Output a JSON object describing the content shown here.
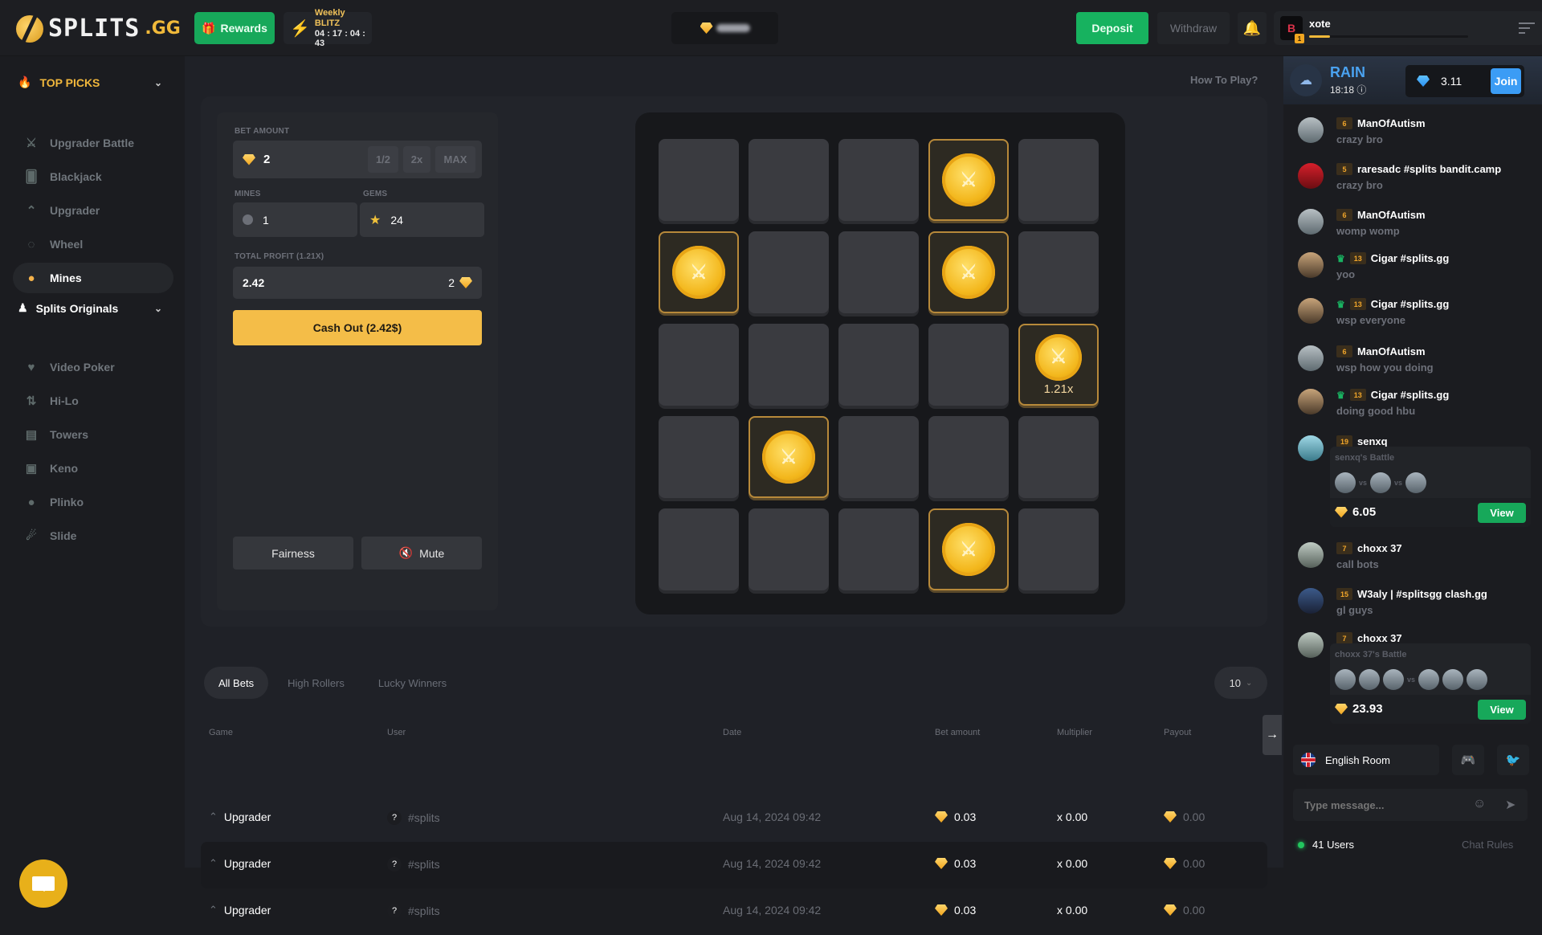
{
  "header": {
    "logo_text": "SPLITS",
    "logo_suffix": ".GG",
    "rewards_label": "Rewards",
    "blitz_title": "Weekly BLITZ",
    "blitz_countdown": "04 : 17 : 04 : 43",
    "deposit_label": "Deposit",
    "withdraw_label": "Withdraw",
    "username": "xote",
    "user_level": "1",
    "xp_progress_percent": 13
  },
  "sidebar": {
    "top_picks_label": "TOP PICKS",
    "top_picks": [
      {
        "label": "Upgrader Battle",
        "icon": "swords-icon"
      },
      {
        "label": "Blackjack",
        "icon": "cards-icon"
      },
      {
        "label": "Upgrader",
        "icon": "chevrons-up-icon"
      },
      {
        "label": "Wheel",
        "icon": "wheel-icon"
      },
      {
        "label": "Mines",
        "icon": "bomb-icon",
        "active": true
      }
    ],
    "originals_label": "Splits Originals",
    "originals": [
      {
        "label": "Video Poker",
        "icon": "poker-cards-icon"
      },
      {
        "label": "Hi-Lo",
        "icon": "hilo-icon"
      },
      {
        "label": "Towers",
        "icon": "towers-icon"
      },
      {
        "label": "Keno",
        "icon": "keno-icon"
      },
      {
        "label": "Plinko",
        "icon": "plinko-icon"
      },
      {
        "label": "Slide",
        "icon": "slide-icon"
      }
    ]
  },
  "game": {
    "how_to_play": "How To Play?",
    "bet_amount_label": "BET AMOUNT",
    "bet_amount": "2",
    "half_label": "1/2",
    "double_label": "2x",
    "max_label": "MAX",
    "mines_label": "MINES",
    "mines_value": "1",
    "gems_label": "GEMS",
    "gems_value": "24",
    "profit_label": "TOTAL PROFIT (1.21X)",
    "profit_value": "2.42",
    "profit_bet": "2",
    "cashout_label": "Cash Out (2.42$)",
    "fairness_label": "Fairness",
    "mute_label": "Mute",
    "grid_rows": 5,
    "grid_cols": 5,
    "revealed_gems": [
      [
        0,
        3
      ],
      [
        1,
        0
      ],
      [
        1,
        3
      ],
      [
        2,
        4
      ],
      [
        3,
        1
      ],
      [
        4,
        3
      ]
    ],
    "last_reveal": [
      2,
      4
    ],
    "last_reveal_multiplier": "1.21x"
  },
  "bets": {
    "tabs": [
      "All Bets",
      "High Rollers",
      "Lucky Winners"
    ],
    "active_tab": 0,
    "page_size": "10",
    "columns": [
      "Game",
      "User",
      "Date",
      "Bet amount",
      "Multiplier",
      "Payout"
    ],
    "rows": [
      {
        "game": "Upgrader",
        "user": "#splits",
        "date": "Aug 14, 2024 09:42",
        "amount": "0.03",
        "multiplier": "x 0.00",
        "payout": "0.00"
      },
      {
        "game": "Upgrader",
        "user": "#splits",
        "date": "Aug 14, 2024 09:42",
        "amount": "0.03",
        "multiplier": "x 0.00",
        "payout": "0.00"
      },
      {
        "game": "Upgrader",
        "user": "#splits",
        "date": "Aug 14, 2024 09:42",
        "amount": "0.03",
        "multiplier": "x 0.00",
        "payout": "0.00"
      }
    ]
  },
  "chat": {
    "rain_title": "RAIN",
    "rain_time": "18:18",
    "rain_amount": "3.11",
    "join_label": "Join",
    "messages": [
      {
        "level": "6",
        "name": "ManOfAutism",
        "text": "crazy bro"
      },
      {
        "level": "5",
        "name": "raresadc #splits bandit.camp",
        "text": "crazy bro"
      },
      {
        "level": "6",
        "name": "ManOfAutism",
        "text": "womp womp"
      },
      {
        "level": "13",
        "name": "Cigar #splits.gg",
        "text": "yoo",
        "crown": true
      },
      {
        "level": "13",
        "name": "Cigar #splits.gg",
        "text": "wsp everyone",
        "crown": true
      },
      {
        "level": "6",
        "name": "ManOfAutism",
        "text": "wsp how you doing"
      },
      {
        "level": "13",
        "name": "Cigar #splits.gg",
        "text": "doing good hbu",
        "crown": true
      },
      {
        "level": "19",
        "name": "senxq",
        "battle": {
          "title": "senxq's Battle",
          "value": "6.05",
          "view_label": "View",
          "vs": "vs"
        }
      },
      {
        "level": "7",
        "name": "choxx 37",
        "text": "call bots"
      },
      {
        "level": "15",
        "name": "W3aly | #splitsgg clash.gg",
        "text": "gl guys"
      },
      {
        "level": "7",
        "name": "choxx 37",
        "battle": {
          "title": "choxx 37's Battle",
          "value": "23.93",
          "view_label": "View",
          "vs": "vs"
        }
      }
    ],
    "room_label": "English Room",
    "input_placeholder": "Type message...",
    "online_count": "41 Users",
    "rules_label": "Chat Rules"
  }
}
